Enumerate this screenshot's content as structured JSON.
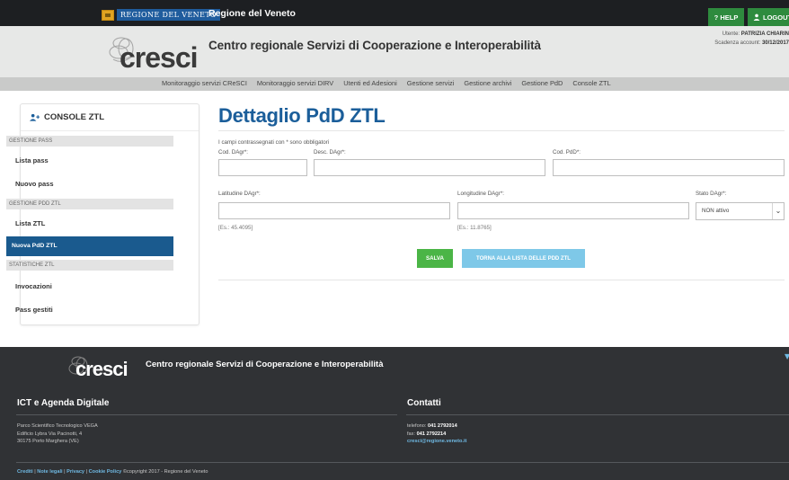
{
  "topbar": {
    "logo_text": "REGIONE DEL VENETO",
    "title": "Regione del Veneto",
    "help_label": "? HELP",
    "logout_label": "LOGOUT"
  },
  "header": {
    "logo_word": "cresci",
    "site_title": "Centro regionale Servizi di Cooperazione e Interoperabilità",
    "user_label": "Utente:",
    "user_name": "PATRIZIA CHIARIN",
    "expiry_label": "Scadenza account:",
    "expiry_date": "30/12/2017"
  },
  "nav": {
    "items": [
      "Monitoraggio servizi CReSCI",
      "Monitoraggio servizi DIRV",
      "Utenti ed Adesioni",
      "Gestione servizi",
      "Gestione archivi",
      "Gestione PdD",
      "Console ZTL"
    ]
  },
  "sidebar": {
    "title": "CONSOLE ZTL",
    "sections": [
      "GESTIONE PASS",
      "GESTIONE PDD ZTL",
      "STATISTICHE ZTL"
    ],
    "items": [
      "Lista pass",
      "Nuovo pass",
      "Lista ZTL",
      "Nuova PdD ZTL",
      "Invocazioni",
      "Pass gestiti"
    ]
  },
  "main": {
    "title": "Dettaglio PdD ZTL",
    "required_note": "I campi contrassegnati con * sono obbligatori",
    "fields": {
      "cod_dagr": {
        "label": "Cod. DAgr*:",
        "value": ""
      },
      "desc_dagr": {
        "label": "Desc. DAgr*:",
        "value": ""
      },
      "cod_pdd": {
        "label": "Cod. PdD*:",
        "value": ""
      },
      "lat_dagr": {
        "label": "Latitudine DAgr*:",
        "value": "",
        "hint": "[Es.: 45.4095]"
      },
      "lon_dagr": {
        "label": "Longitudine DAgr*:",
        "value": "",
        "hint": "[Es.: 11.8765]"
      },
      "stato_dagr": {
        "label": "Stato DAgr*:",
        "selected": "NON attivo"
      }
    },
    "save_label": "SALVA",
    "back_label": "TORNA ALLA LISTA DELLE PDD ZTL"
  },
  "footer": {
    "logo_word": "cresci",
    "site_title": "Centro regionale Servizi di Cooperazione e Interoperabilità",
    "ict_heading": "ICT e Agenda Digitale",
    "address_lines": [
      "Parco Scientifico Tecnologico VEGA",
      "Edificio Lybra Via Pacinotti, 4",
      "30175 Porto Marghera (VE)"
    ],
    "contacts_heading": "Contatti",
    "phone_label": "telefono:",
    "phone": "041 2792014",
    "fax_label": "fax:",
    "fax": "041 2792214",
    "email": "cresci@regione.veneto.it",
    "links": [
      "Crediti",
      "Note legali",
      "Privacy",
      "Cookie Policy"
    ],
    "copyright": "©copyright 2017 - Regione del Veneto"
  },
  "colors": {
    "brand_blue": "#1b5e9a",
    "active_item": "#1a5a8e",
    "save_green": "#4bb546",
    "back_blue": "#7ec8e8",
    "topbar_dark": "#1d1f22",
    "footer_dark": "#303235"
  }
}
